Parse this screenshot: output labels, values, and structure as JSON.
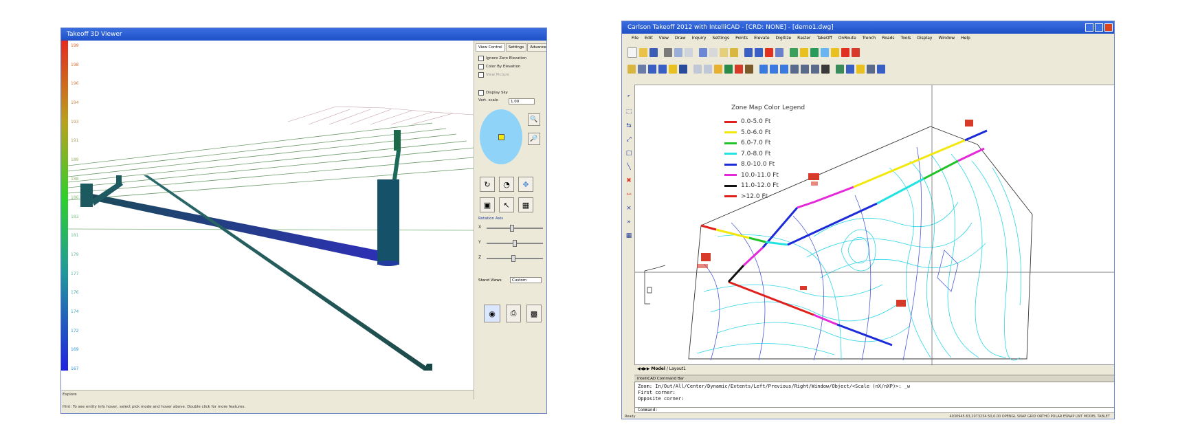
{
  "viewer": {
    "title": "Takeoff 3D Viewer",
    "scale_labels": [
      "199",
      "198",
      "196",
      "194",
      "193",
      "191",
      "189",
      "188",
      "186",
      "183",
      "181",
      "179",
      "177",
      "176",
      "174",
      "172",
      "169",
      "167"
    ],
    "tabs": [
      "View Control",
      "Settings",
      "Advanced"
    ],
    "options": {
      "ignore_zero_elevation": "Ignore Zero Elevation",
      "color_by_elevation": "Color By Elevation",
      "view_picture": "View Picture",
      "display_sky": "Display Sky"
    },
    "vert_scale_label": "Vert. scale",
    "vert_scale_value": "1.00",
    "rotation_axis_label": "Rotation Axis",
    "axis_labels": [
      "X",
      "Y",
      "Z"
    ],
    "stand_views_label": "Stand Views",
    "stand_views_value": "Custom",
    "explore_label": "Explore",
    "hint": "Hint: To see entity info hover, select pick mode and hover above. Double click for more features."
  },
  "cad": {
    "title": "Carlson Takeoff 2012 with IntelliCAD - [CRD: NONE] - [demo1.dwg]",
    "menus": [
      "File",
      "Edit",
      "View",
      "Draw",
      "Inquiry",
      "Settings",
      "Points",
      "Elevate",
      "Digitize",
      "Raster",
      "TakeOff",
      "OnRoute",
      "Trench",
      "Roads",
      "Tools",
      "Display",
      "Window",
      "Help"
    ],
    "legend_title": "Zone Map Color Legend",
    "legend": [
      {
        "label": "0.0-5.0 Ft",
        "color": "#e0201c"
      },
      {
        "label": "5.0-6.0 Ft",
        "color": "#f2e80c"
      },
      {
        "label": "6.0-7.0 Ft",
        "color": "#22c32a"
      },
      {
        "label": "7.0-8.0 Ft",
        "color": "#22e3e0"
      },
      {
        "label": "8.0-10.0 Ft",
        "color": "#1c2bd8"
      },
      {
        "label": "10.0-11.0 Ft",
        "color": "#e528d8"
      },
      {
        "label": "11.0-12.0 Ft",
        "color": "#111111"
      },
      {
        "label": ">12.0 Ft",
        "color": "#e0201c"
      }
    ],
    "model_tab": "Model",
    "layout_tab": "Layout1",
    "command_bar_title": "IntelliCAD Command Bar",
    "command_lines": [
      "Zoom: In/Out/All/Center/Dynamic/Extents/Left/Previous/Right/Window/Object/<Scale (nX/nXP)>: _w",
      "First corner:",
      "Opposite corner:"
    ],
    "command_prompt": "Command:",
    "status_left": "Ready",
    "status_right": "4030945.63,2073234.50,0.00     OPENGL  SNAP GRID ORTHO POLAR ESNAP LWT  MODEL  TABLET"
  }
}
